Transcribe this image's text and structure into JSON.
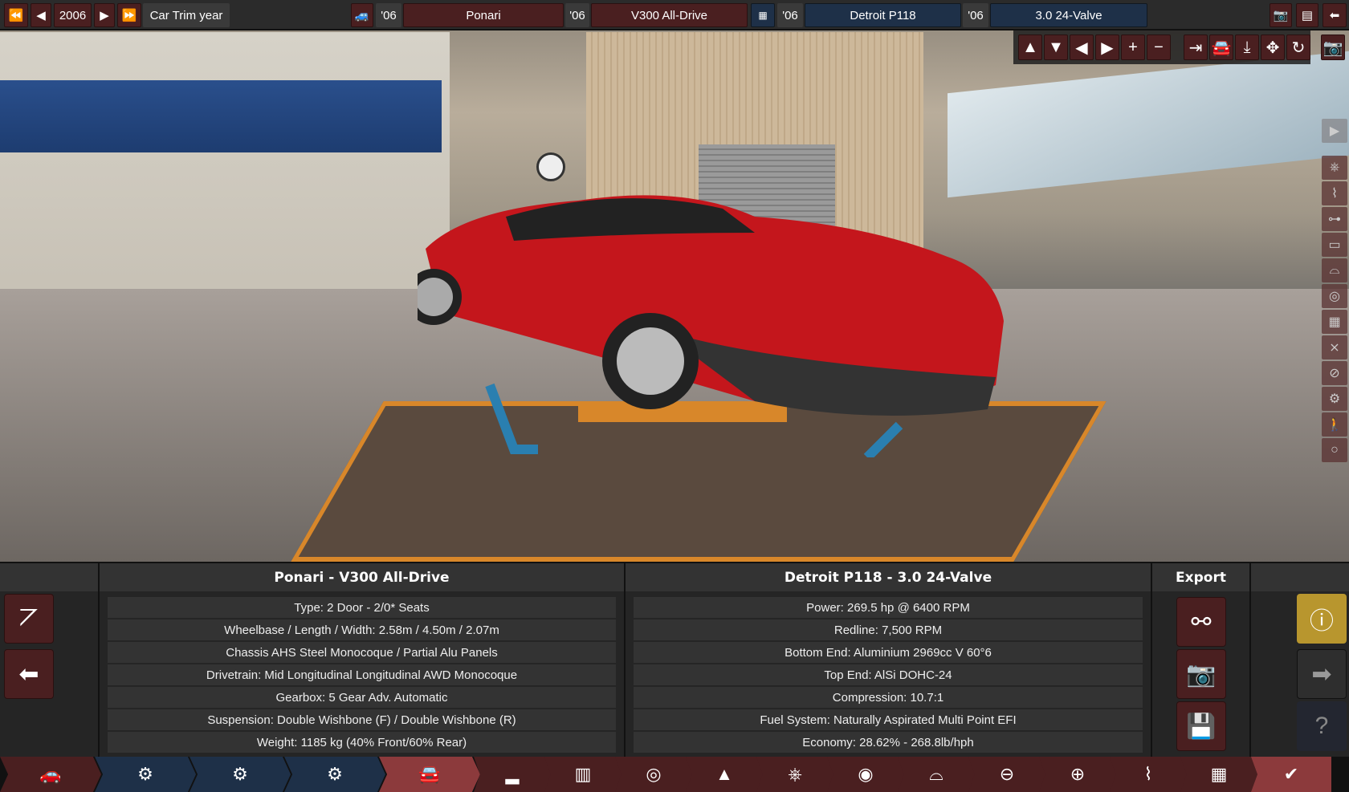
{
  "topbar": {
    "year": "2006",
    "year_label": "Car Trim year",
    "car_year": "'06",
    "car_model": "Ponari",
    "trim_year": "'06",
    "trim": "V300 All-Drive",
    "engine_year": "'06",
    "engine_family": "Detroit P118",
    "variant_year": "'06",
    "variant": "3.0 24-Valve"
  },
  "car_panel": {
    "title": "Ponari - V300 All-Drive",
    "rows": [
      "Type: 2 Door - 2/0* Seats",
      "Wheelbase / Length / Width: 2.58m / 4.50m / 2.07m",
      "Chassis AHS Steel Monocoque / Partial Alu Panels",
      "Drivetrain: Mid Longitudinal Longitudinal AWD Monocoque",
      "Gearbox: 5 Gear Adv. Automatic",
      "Suspension: Double Wishbone (F) / Double Wishbone (R)",
      "Weight: 1185 kg (40% Front/60% Rear)"
    ]
  },
  "engine_panel": {
    "title": "Detroit P118 - 3.0 24-Valve",
    "rows": [
      "Power: 269.5 hp @ 6400 RPM",
      "Redline:  7,500 RPM",
      "Bottom End: Aluminium 2969cc V 60°6",
      "Top End: AlSi DOHC-24",
      "Compression: 10.7:1",
      "Fuel System: Naturally Aspirated Multi Point EFI",
      "Economy: 28.62% - 268.8lb/hph"
    ]
  },
  "export": {
    "title": "Export"
  },
  "colors": {
    "red_button": "#4a1f20",
    "blue_button": "#1e3048",
    "warning": "#b8962e",
    "nav_active": "#8c3a3c"
  }
}
